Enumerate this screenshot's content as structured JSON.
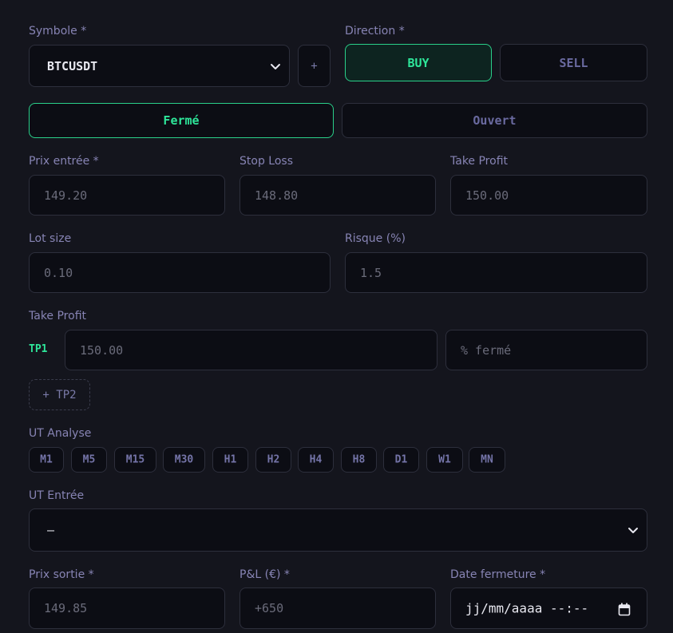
{
  "symbol": {
    "label": "Symbole *",
    "value": "BTCUSDT",
    "add_label": "+"
  },
  "direction": {
    "label": "Direction *",
    "buy_label": "BUY",
    "sell_label": "SELL"
  },
  "status": {
    "closed_label": "Fermé",
    "open_label": "Ouvert"
  },
  "entry_price": {
    "label": "Prix entrée *",
    "value": "149.20"
  },
  "stop_loss": {
    "label": "Stop Loss",
    "value": "148.80"
  },
  "take_profit_main": {
    "label": "Take Profit",
    "value": "150.00"
  },
  "lot_size": {
    "label": "Lot size",
    "value": "0.10"
  },
  "risk": {
    "label": "Risque (%)",
    "value": "1.5"
  },
  "take_profits": {
    "label": "Take Profit",
    "tp1_tag": "TP1",
    "tp1_value": "150.00",
    "tp1_percent_placeholder": "% fermé",
    "add_tp_label": "+ TP2"
  },
  "ut_analysis": {
    "label": "UT Analyse",
    "options": [
      "M1",
      "M5",
      "M15",
      "M30",
      "H1",
      "H2",
      "H4",
      "H8",
      "D1",
      "W1",
      "MN"
    ]
  },
  "ut_entry": {
    "label": "UT Entrée",
    "value": "—"
  },
  "exit_price": {
    "label": "Prix sortie *",
    "value": "149.85"
  },
  "pnl": {
    "label": "P&L (€) *",
    "value": "+650"
  },
  "close_date": {
    "label": "Date fermeture *",
    "value": "jj/mm/aaaa --:--"
  },
  "colors": {
    "accent_green": "#2ee69a",
    "background": "#14151d",
    "field_bg": "#0c0d14",
    "label_purple": "#8784b4"
  }
}
